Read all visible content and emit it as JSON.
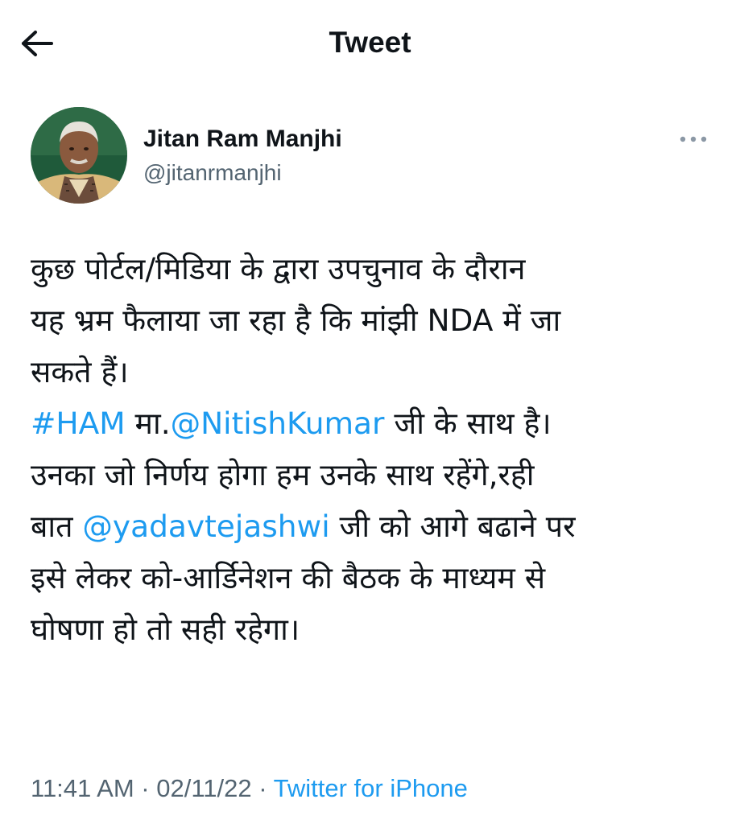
{
  "header": {
    "title": "Tweet",
    "back_icon": "arrow-left-icon"
  },
  "author": {
    "display_name": "Jitan Ram Manjhi",
    "handle": "@jitanrmanjhi",
    "more_icon": "more-horizontal-icon"
  },
  "tweet": {
    "line1": "कुछ पोर्टल/मिडिया के द्वारा उपचुनाव के दौरान",
    "line2": "यह भ्रम फैलाया जा रहा है कि मांझी NDA में जा",
    "line3": "सकते हैं।",
    "line4_hashtag": "#HAM",
    "line4_text_a": " मा.",
    "line4_mention": "@NitishKumar",
    "line4_text_b": " जी के साथ है।",
    "line5": "उनका जो निर्णय होगा हम उनके साथ रहेंगे,रही",
    "line6_text_a": "बात ",
    "line6_mention": "@yadavtejashwi",
    "line6_text_b": " जी को आगे बढाने पर",
    "line7": "इसे लेकर को-आर्डिनेशन की बैठक के माध्यम से",
    "line8": "घोषणा हो तो सही रहेगा।"
  },
  "meta": {
    "time": "11:41 AM",
    "separator": " · ",
    "date": "02/11/22",
    "source": "Twitter for iPhone"
  },
  "colors": {
    "text": "#0f1419",
    "secondary": "#536471",
    "link": "#1d9bf0",
    "background": "#ffffff"
  }
}
